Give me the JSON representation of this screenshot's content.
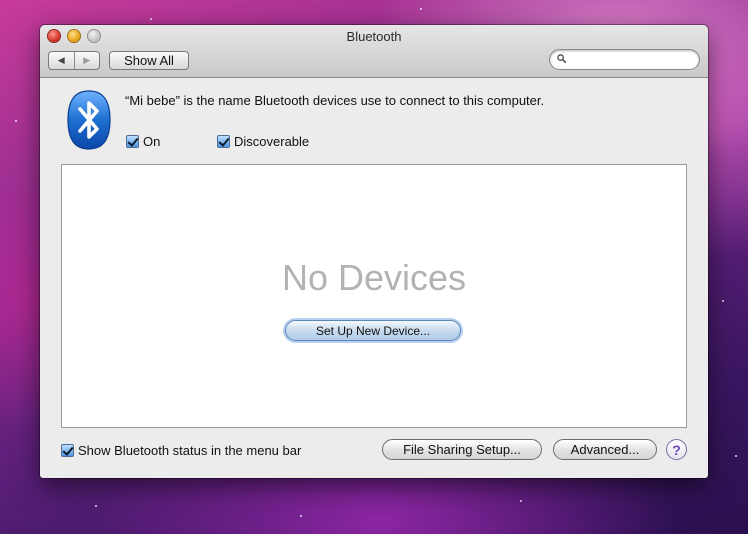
{
  "window": {
    "title": "Bluetooth"
  },
  "toolbar": {
    "back_glyph": "◀",
    "forward_glyph": "▶",
    "show_all_label": "Show All",
    "search_placeholder": ""
  },
  "main": {
    "status_text": "“Mi bebe” is the name Bluetooth devices use to connect to this computer.",
    "on_label": "On",
    "on_checked": true,
    "discoverable_label": "Discoverable",
    "discoverable_checked": true,
    "empty_message": "No Devices",
    "setup_button_label": "Set Up New Device..."
  },
  "footer": {
    "menu_bar_label": "Show Bluetooth status in the menu bar",
    "menu_bar_checked": true,
    "file_sharing_label": "File Sharing Setup...",
    "advanced_label": "Advanced...",
    "help_label": "?"
  },
  "colors": {
    "bluetooth_blue": "#1f6fd1",
    "help_purple": "#6b46b8",
    "empty_text_gray": "#b3b3b3"
  },
  "icons": [
    "close-icon",
    "minimize-icon",
    "zoom-icon",
    "back-arrow-icon",
    "forward-arrow-icon",
    "search-icon",
    "bluetooth-icon",
    "help-icon"
  ]
}
